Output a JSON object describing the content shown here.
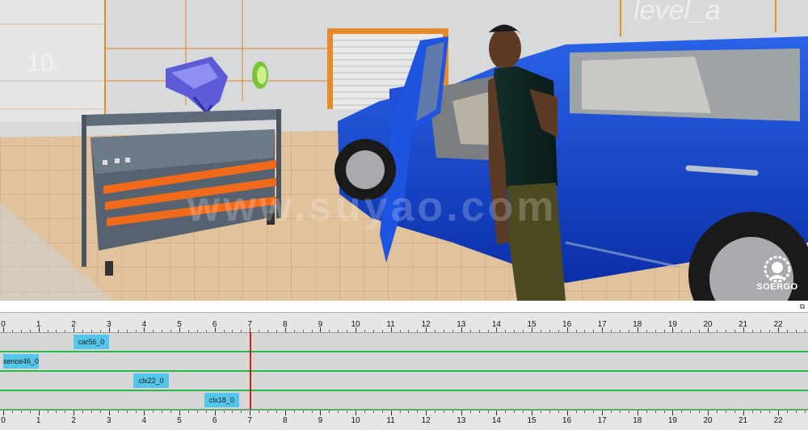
{
  "scene": {
    "watermark": "www.suyao.com",
    "wall_label": "level_a",
    "wall_number": "10",
    "logo_text": "SOERGO"
  },
  "timeline": {
    "restore_icon": "window-restore-icon",
    "ticks": [
      "0",
      "1",
      "2",
      "3",
      "4",
      "5",
      "6",
      "7",
      "8",
      "9",
      "10",
      "11",
      "12",
      "13",
      "14",
      "15",
      "16",
      "17",
      "18",
      "19",
      "20",
      "21",
      "22"
    ],
    "playhead_time": 7,
    "tracks": [
      {
        "clip_label": "car56_0",
        "start": 2.0,
        "end": 3.0
      },
      {
        "clip_label": "sence46_0",
        "start": 0.0,
        "end": 1.0
      },
      {
        "clip_label": "clx22_0",
        "start": 3.7,
        "end": 4.7
      },
      {
        "clip_label": "clx18_0",
        "start": 5.7,
        "end": 6.7
      }
    ],
    "colors": {
      "clip": "#53c6ea",
      "track_line": "#2db54d",
      "playhead": "#d0201a"
    }
  }
}
